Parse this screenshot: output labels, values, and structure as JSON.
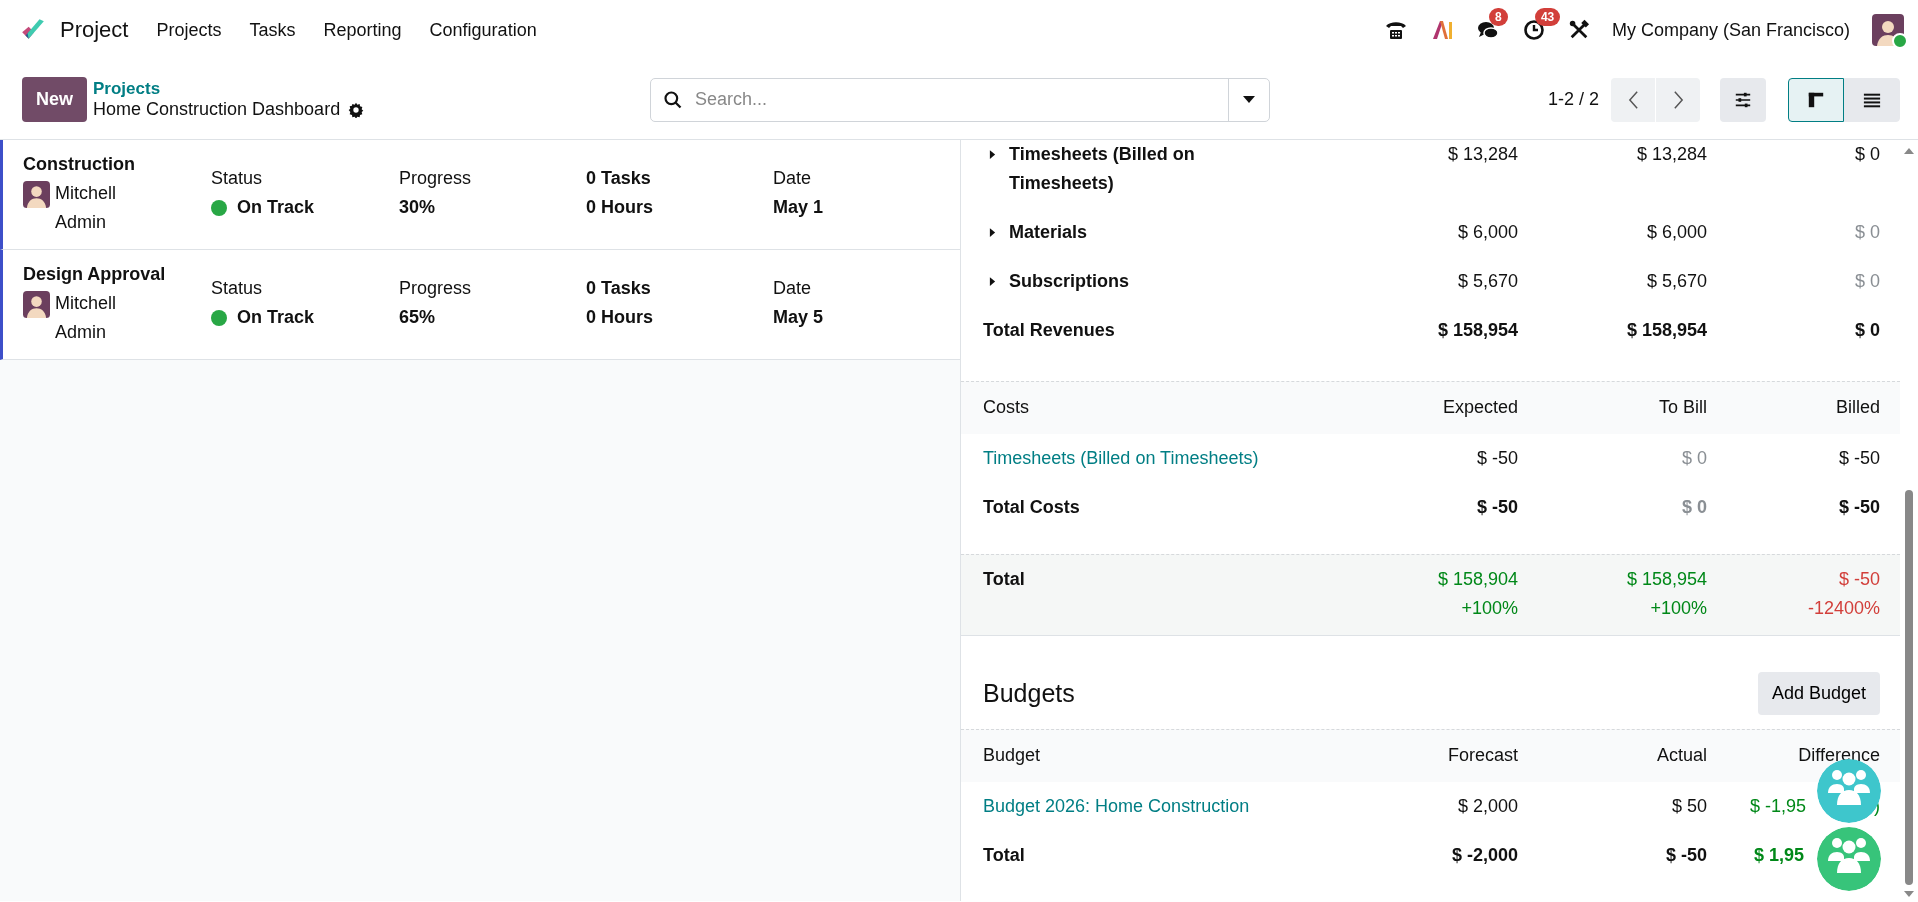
{
  "app": {
    "name": "Project"
  },
  "menu": [
    "Projects",
    "Tasks",
    "Reporting",
    "Configuration"
  ],
  "systray": {
    "chat_count": "8",
    "activity_count": "43",
    "company": "My Company (San Francisco)"
  },
  "control": {
    "new_button": "New",
    "breadcrumb_parent": "Projects",
    "breadcrumb_current": "Home Construction Dashboard",
    "search_placeholder": "Search...",
    "pager": "1-2 / 2",
    "views": [
      {
        "kind": "kanban",
        "selected": true
      },
      {
        "kind": "list",
        "selected": false
      }
    ]
  },
  "projects": [
    {
      "name": "Construction",
      "owner": "Mitchell Admin",
      "status_label": "Status",
      "status": "On Track",
      "color": "#28a745",
      "progress_label": "Progress",
      "progress": "30%",
      "tasks": "0 Tasks",
      "hours": "0 Hours",
      "date_label": "Date",
      "date": "May 1"
    },
    {
      "name": "Design Approval",
      "owner": "Mitchell Admin",
      "status_label": "Status",
      "status": "On Track",
      "color": "#28a745",
      "progress_label": "Progress",
      "progress": "65%",
      "tasks": "0 Tasks",
      "hours": "0 Hours",
      "date_label": "Date",
      "date": "May 5"
    }
  ],
  "revenues": {
    "rows": [
      {
        "label": "Timesheets (Billed on Timesheets)",
        "expanded": false,
        "cells": [
          {
            "text": "$ 13,284",
            "muted": false
          },
          {
            "text": "$ 13,284",
            "muted": false
          },
          {
            "text": "$ 0",
            "muted": false
          }
        ]
      },
      {
        "label": "Materials",
        "expanded": false,
        "cells": [
          {
            "text": "$ 6,000",
            "muted": false
          },
          {
            "text": "$ 6,000",
            "muted": false
          },
          {
            "text": "$ 0",
            "muted": true
          }
        ]
      },
      {
        "label": "Subscriptions",
        "expanded": false,
        "cells": [
          {
            "text": "$ 5,670",
            "muted": false
          },
          {
            "text": "$ 5,670",
            "muted": false
          },
          {
            "text": "$ 0",
            "muted": true
          }
        ]
      }
    ],
    "total": {
      "label": "Total Revenues",
      "cells": [
        {
          "text": "$ 158,954",
          "muted": false
        },
        {
          "text": "$ 158,954",
          "muted": false
        },
        {
          "text": "$ 0",
          "muted": false
        }
      ]
    }
  },
  "costs": {
    "heading": "Costs",
    "columns": [
      "Expected",
      "To Bill",
      "Billed"
    ],
    "rows": [
      {
        "label": "Timesheets (Billed on Timesheets)",
        "cells": [
          {
            "text": "$ -50",
            "muted": false
          },
          {
            "text": "$ 0",
            "muted": true
          },
          {
            "text": "$ -50",
            "muted": false
          }
        ]
      }
    ],
    "total": {
      "label": "Total Costs",
      "cells": [
        {
          "text": "$ -50",
          "muted": false
        },
        {
          "text": "$ 0",
          "muted": true
        },
        {
          "text": "$ -50",
          "muted": false
        }
      ]
    }
  },
  "grand_total": {
    "label": "Total",
    "cells": [
      {
        "value": "$ 158,904",
        "percent": "+100%",
        "color": "#008818"
      },
      {
        "value": "$ 158,954",
        "percent": "+100%",
        "color": "#008818"
      },
      {
        "value": "$ -50",
        "percent": "-12400%",
        "color": "#d23f3a"
      }
    ]
  },
  "budgets": {
    "title": "Budgets",
    "add_button": "Add Budget",
    "columns": [
      "Budget",
      "Forecast",
      "Actual",
      "Difference"
    ],
    "rows": [
      {
        "label": "Budget 2026: Home Construction",
        "forecast": "$ 2,000",
        "actual": "$ 50",
        "difference": "$ -1,95",
        "difference_tail": ")",
        "color": "#008818"
      }
    ],
    "total": {
      "label": "Total",
      "forecast": "$ -2,000",
      "actual": "$ -50",
      "difference": "$ 1,95",
      "color": "#008818"
    }
  }
}
